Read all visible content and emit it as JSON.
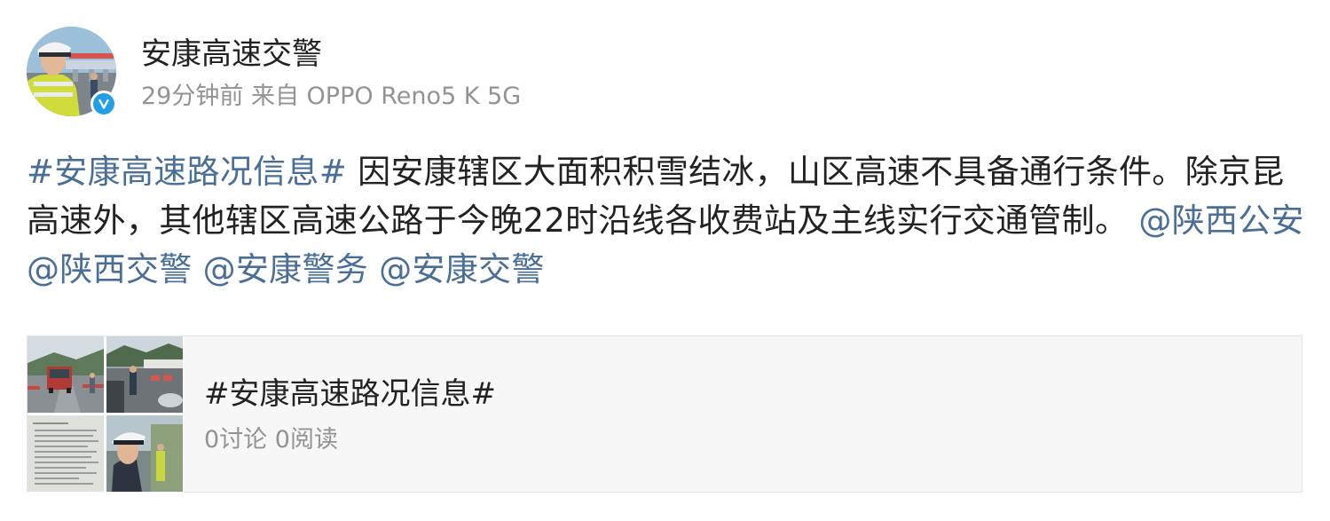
{
  "author": {
    "name": "安康高速交警",
    "verified": true,
    "avatar": "traffic-police-officer-photo"
  },
  "meta": {
    "time": "29分钟前",
    "source_prefix": "来自",
    "source_device": "OPPO Reno5 K 5G"
  },
  "post": {
    "topic": "#安康高速路况信息#",
    "text": " 因安康辖区大面积积雪结冰，山区高速不具备通行条件。除京昆高速外，其他辖区高速公路于今晚22时沿线各收费站及主线实行交通管制。",
    "mentions": [
      "@陕西公安",
      "@陕西交警",
      "@安康警务",
      "@安康交警"
    ]
  },
  "topic_card": {
    "title": "#安康高速路况信息#",
    "discussions": "0讨论",
    "reads": "0阅读",
    "thumbnails": [
      "truck-on-highway-photo",
      "officer-at-toll-plaza-photo",
      "traffic-control-notice-photo",
      "police-officer-closeup-photo"
    ]
  },
  "colors": {
    "link": "#4a6f96",
    "meta": "#939393",
    "verified": "#21a0e6",
    "card_bg": "#f7f7f7"
  }
}
